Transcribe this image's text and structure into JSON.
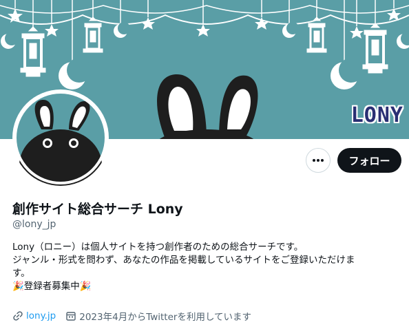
{
  "banner": {
    "logo_text": "LONY",
    "background_color": "#5a9ea6"
  },
  "actions": {
    "more_icon": "ellipsis-icon",
    "follow_label": "フォロー"
  },
  "profile": {
    "display_name": "創作サイト総合サーチ Lony",
    "handle": "@lony_jp",
    "bio_lines": [
      "Lony（ロニー）は個人サイトを持つ創作者のための総合サーチです。",
      "ジャンル・形式を問わず、あなたの作品を掲載しているサイトをご登録いただけま",
      "す。",
      "🎉登録者募集中🎉"
    ],
    "website": "lony.jp",
    "joined": "2023年4月からTwitterを利用しています"
  },
  "colors": {
    "accent": "#1d9bf0",
    "follow_bg": "#0f1419",
    "muted": "#536471"
  }
}
